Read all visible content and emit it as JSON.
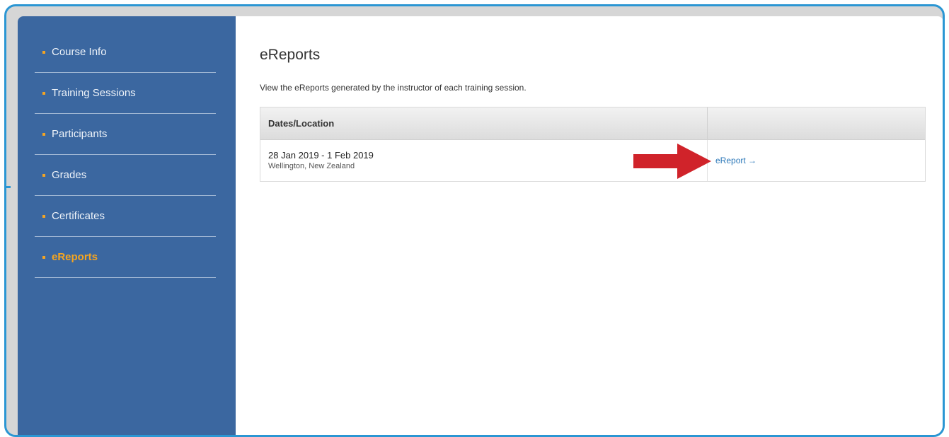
{
  "sidebar": {
    "items": [
      {
        "label": "Course Info"
      },
      {
        "label": "Training Sessions"
      },
      {
        "label": "Participants"
      },
      {
        "label": "Grades"
      },
      {
        "label": "Certificates"
      },
      {
        "label": "eReports",
        "active": true
      }
    ]
  },
  "main": {
    "title": "eReports",
    "description": "View the eReports generated by the instructor of each training session.",
    "table": {
      "headers": [
        "Dates/Location",
        ""
      ],
      "rows": [
        {
          "dates": "28 Jan 2019 - 1 Feb 2019",
          "location": "Wellington, New Zealand",
          "link_label": "eReport →"
        }
      ]
    }
  },
  "colors": {
    "sidebar_bg": "#3b67a0",
    "active_item": "#f6a51f",
    "bullet": "#f4a422",
    "frame_border": "#2b96d3",
    "link": "#2a77b8",
    "annotation_arrow": "#d0232a"
  },
  "icons": {
    "annotation": "red-arrow-icon"
  }
}
